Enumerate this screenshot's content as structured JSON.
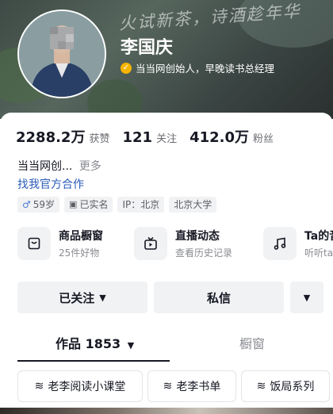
{
  "banner": {
    "calligraphy": "火试新茶，诗酒趁年华"
  },
  "profile": {
    "name": "李国庆",
    "verify_text": "当当网创始人，早晚读书总经理"
  },
  "stats": [
    {
      "number": "2288.2万",
      "label": "获赞"
    },
    {
      "number": "121",
      "label": "关注"
    },
    {
      "number": "412.0万",
      "label": "粉丝"
    }
  ],
  "bio": {
    "text": "当当网创...",
    "more": "更多"
  },
  "cooperation_link": "找我官方合作",
  "tags": {
    "age": "59岁",
    "realname": "已实名",
    "ip": "IP：北京",
    "school": "北京大学"
  },
  "features": [
    {
      "title": "商品橱窗",
      "subtitle": "25件好物",
      "icon": "shopping-bag-icon"
    },
    {
      "title": "直播动态",
      "subtitle": "查看历史记录",
      "icon": "tv-icon"
    },
    {
      "title": "Ta的音乐",
      "subtitle": "听听ta的音乐",
      "icon": "music-note-icon"
    }
  ],
  "actions": {
    "follow_label": "已关注",
    "message_label": "私信"
  },
  "tabs": {
    "works_label": "作品 1853",
    "showcase_label": "橱窗"
  },
  "collections": [
    {
      "label": "老李阅读小课堂"
    },
    {
      "label": "老李书单"
    },
    {
      "label": "饭局系列"
    }
  ],
  "colors": {
    "link": "#2b5cb8",
    "verified": "#f5b400",
    "male": "#4a7ad8"
  }
}
